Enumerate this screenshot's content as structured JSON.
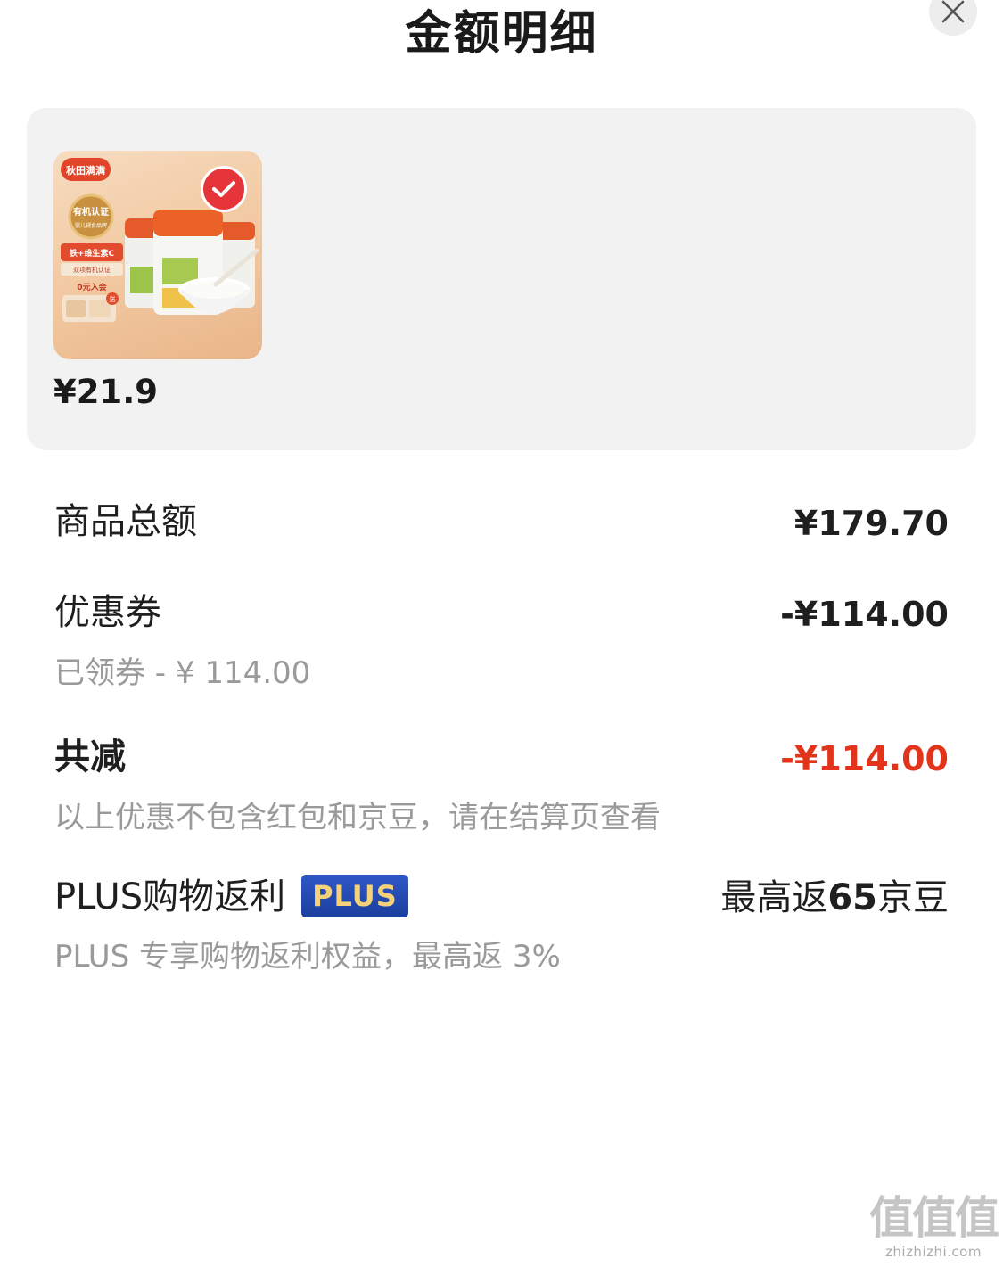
{
  "header": {
    "title": "金额明细",
    "close_icon": "close-icon"
  },
  "product": {
    "price": "¥21.9",
    "selected": true,
    "thumbnail_icon": "product-image",
    "check_icon": "check-icon",
    "thumbnail_text": {
      "brand": "秋田满满",
      "organic_seal": "有机认证",
      "seal_sub": "婴儿辅食品牌",
      "promo1": "铁+维生素C",
      "promo2": "双项有机认证",
      "promo3": "0元入会",
      "gift": "送"
    }
  },
  "rows": {
    "total": {
      "label": "商品总额",
      "value": "¥179.70"
    },
    "coupon": {
      "label": "优惠券",
      "value": "-¥114.00",
      "sub": "已领券 - ¥ 114.00"
    },
    "reduction": {
      "label": "共减",
      "value": "-¥114.00",
      "sub": "以上优惠不包含红包和京豆，请在结算页查看"
    },
    "plus": {
      "label": "PLUS购物返利",
      "badge": "PLUS",
      "value_prefix": "最高返",
      "value_number": "65",
      "value_suffix": "京豆",
      "sub": "PLUS 专享购物返利权益，最高返 3%"
    }
  },
  "watermark": {
    "mark": "值值值",
    "domain": "zhizhizhi.com"
  },
  "colors": {
    "red": "#e2331b",
    "card_bg": "#f2f2f2",
    "plus_badge_bg": "#1b3f9e",
    "plus_badge_text": "#f5d27a",
    "muted_text": "#9a9a9a"
  }
}
